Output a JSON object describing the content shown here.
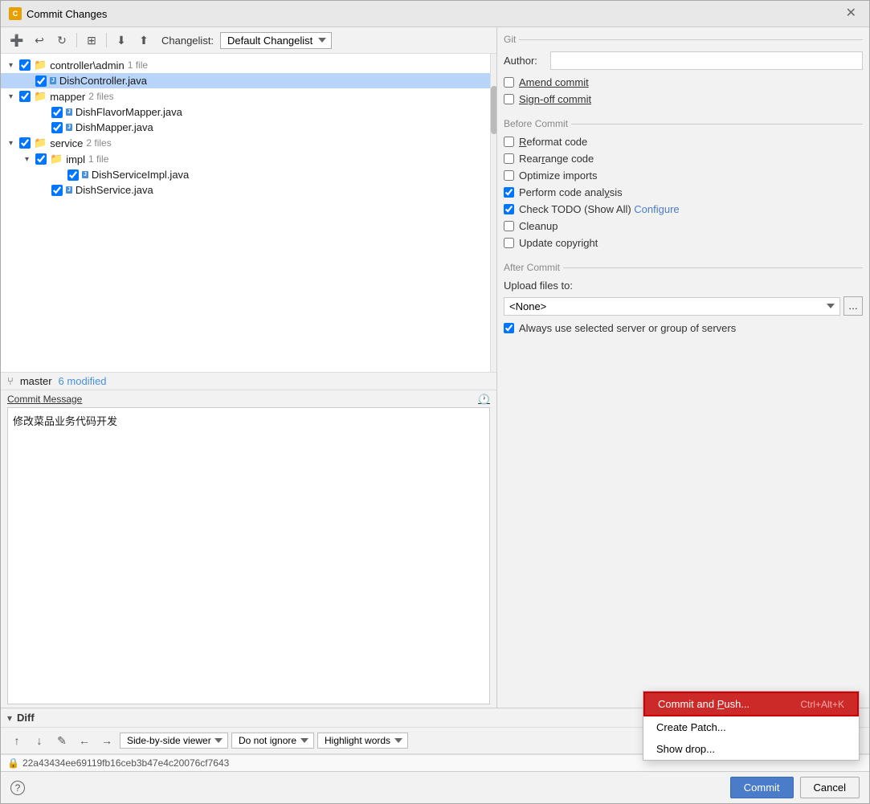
{
  "window": {
    "title": "Commit Changes",
    "icon": "C"
  },
  "toolbar": {
    "changelist_label": "Changelist:",
    "changelist_value": "Default Changelist"
  },
  "file_tree": {
    "items": [
      {
        "indent": 1,
        "type": "folder",
        "label": "controller\\admin",
        "count": "1 file",
        "checked": true,
        "chevron": "▾"
      },
      {
        "indent": 2,
        "type": "file",
        "label": "DishController.java",
        "checked": true,
        "selected": true
      },
      {
        "indent": 1,
        "type": "folder",
        "label": "mapper",
        "count": "2 files",
        "checked": true,
        "chevron": "▾"
      },
      {
        "indent": 3,
        "type": "file",
        "label": "DishFlavorMapper.java",
        "checked": true
      },
      {
        "indent": 3,
        "type": "file",
        "label": "DishMapper.java",
        "checked": true
      },
      {
        "indent": 1,
        "type": "folder",
        "label": "service",
        "count": "2 files",
        "checked": true,
        "chevron": "▾"
      },
      {
        "indent": 2,
        "type": "folder",
        "label": "impl",
        "count": "1 file",
        "checked": true,
        "chevron": "▾"
      },
      {
        "indent": 4,
        "type": "file",
        "label": "DishServiceImpl.java",
        "checked": true
      },
      {
        "indent": 3,
        "type": "file",
        "label": "DishService.java",
        "checked": true
      }
    ]
  },
  "status_bar": {
    "branch": "master",
    "modified": "6 modified"
  },
  "commit_message": {
    "label": "Commit Message",
    "value": "修改菜品业务代码开发"
  },
  "git_section": {
    "title": "Git",
    "author_label": "Author:",
    "author_value": "",
    "amend_commit": "Amend commit",
    "sign_off_commit": "Sign-off commit"
  },
  "before_commit": {
    "title": "Before Commit",
    "items": [
      {
        "id": "reformat",
        "label": "Reformat code",
        "checked": false
      },
      {
        "id": "rearrange",
        "label": "Rearrange code",
        "checked": false
      },
      {
        "id": "optimize",
        "label": "Optimize imports",
        "checked": false
      },
      {
        "id": "analyze",
        "label": "Perform code analysis",
        "checked": true
      },
      {
        "id": "todo",
        "label": "Check TODO (Show All)",
        "checked": true,
        "configure": "Configure"
      },
      {
        "id": "cleanup",
        "label": "Cleanup",
        "checked": false
      },
      {
        "id": "copyright",
        "label": "Update copyright",
        "checked": false
      }
    ]
  },
  "after_commit": {
    "title": "After Commit",
    "upload_label": "Upload files to:",
    "upload_value": "<None>",
    "always_use": "Always use selected server or group of servers",
    "always_use_checked": true
  },
  "diff_section": {
    "title": "Diff",
    "viewer": "Side-by-side viewer",
    "ignore": "Do not ignore",
    "highlight": "Highlight words",
    "hash": "22a43434ee69119fb16ceb3b47e4c20076cf7643"
  },
  "dropdown_menu": {
    "items": [
      {
        "label": "Commit and Push...",
        "shortcut": "Ctrl+Alt+K",
        "highlighted": true
      },
      {
        "label": "Create Patch...",
        "shortcut": ""
      },
      {
        "label": "Show drop...",
        "shortcut": ""
      }
    ]
  },
  "bottom_bar": {
    "commit_btn": "Commit",
    "cancel_btn": "Cancel"
  }
}
